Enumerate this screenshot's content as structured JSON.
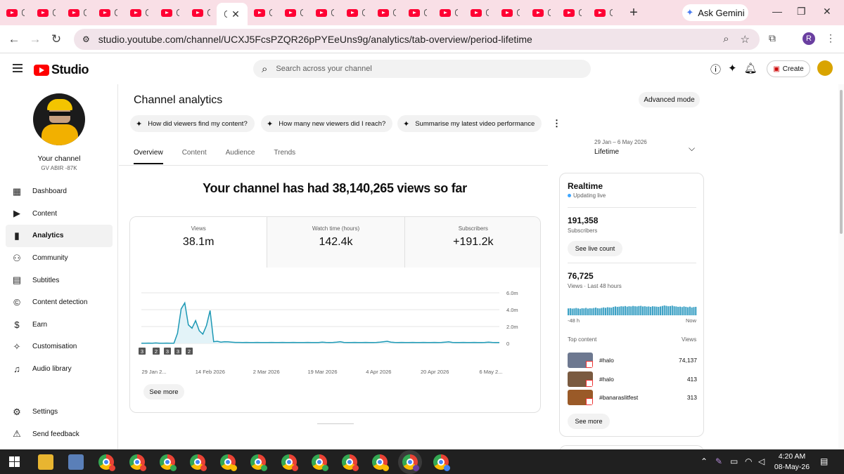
{
  "browser": {
    "ask_gemini": "Ask Gemini",
    "url": "studio.youtube.com/channel/UCXJ5FcsPZQR26pPYEeUns9g/analytics/tab-overview/period-lifetime",
    "profile_initial": "R"
  },
  "header": {
    "logo_text": "Studio",
    "search_placeholder": "Search across your channel",
    "create_label": "Create"
  },
  "sidebar": {
    "channel_name": "Your channel",
    "channel_handle": "GV ABIR -87K",
    "items": [
      {
        "label": "Dashboard",
        "icon": "dashboard-icon"
      },
      {
        "label": "Content",
        "icon": "content-icon"
      },
      {
        "label": "Analytics",
        "icon": "analytics-icon"
      },
      {
        "label": "Community",
        "icon": "community-icon"
      },
      {
        "label": "Subtitles",
        "icon": "subtitles-icon"
      },
      {
        "label": "Content detection",
        "icon": "copyright-icon"
      },
      {
        "label": "Earn",
        "icon": "earn-icon"
      },
      {
        "label": "Customisation",
        "icon": "magic-wand-icon"
      },
      {
        "label": "Audio library",
        "icon": "audio-library-icon"
      }
    ],
    "bottom": [
      {
        "label": "Settings",
        "icon": "gear-icon"
      },
      {
        "label": "Send feedback",
        "icon": "feedback-icon"
      }
    ],
    "active_index": 2
  },
  "analytics": {
    "title": "Channel analytics",
    "advanced_mode": "Advanced mode",
    "chips": [
      "How did viewers find my content?",
      "How many new viewers did I reach?",
      "Summarise my latest video performance"
    ],
    "tabs": [
      "Overview",
      "Content",
      "Audience",
      "Trends"
    ],
    "period_range": "29 Jan – 6 May 2026",
    "period_label": "Lifetime",
    "headline": "Your channel has had 38,140,265 views so far",
    "metrics": [
      {
        "label": "Views",
        "value": "38.1m"
      },
      {
        "label": "Watch time (hours)",
        "value": "142.4k"
      },
      {
        "label": "Subscribers",
        "value": "+191.2k"
      }
    ],
    "see_more": "See more"
  },
  "chart_data": {
    "type": "line",
    "x_labels": [
      "29 Jan 2...",
      "14 Feb 2026",
      "2 Mar 2026",
      "19 Mar 2026",
      "4 Apr 2026",
      "20 Apr 2026",
      "6 May 2..."
    ],
    "y_ticks": [
      "6.0m",
      "4.0m",
      "2.0m",
      "0"
    ],
    "ylim": [
      0,
      6.0
    ],
    "y_unit": "m",
    "markers": [
      "3",
      "2",
      "3",
      "3",
      "2"
    ],
    "series": [
      {
        "color": "#1c98b4",
        "values": [
          0.02,
          0.02,
          0.03,
          0.02,
          0.05,
          0.02,
          0.02,
          0.03,
          0.02,
          0.02,
          1.2,
          4.1,
          4.8,
          2.2,
          1.8,
          2.7,
          1.5,
          1.1,
          2.1,
          3.9,
          0.2,
          0.25,
          0.15,
          0.2,
          0.18,
          0.15,
          0.12,
          0.12,
          0.1,
          0.12,
          0.1,
          0.1,
          0.12,
          0.1,
          0.1,
          0.1,
          0.12,
          0.1,
          0.1,
          0.12,
          0.1,
          0.1,
          0.12,
          0.1,
          0.1,
          0.1,
          0.12,
          0.1,
          0.1,
          0.1,
          0.15,
          0.12,
          0.1,
          0.12,
          0.15,
          0.2,
          0.12,
          0.1,
          0.1,
          0.12,
          0.1,
          0.1,
          0.12,
          0.1,
          0.1,
          0.12,
          0.15,
          0.2,
          0.25,
          0.15,
          0.12,
          0.1,
          0.12,
          0.1,
          0.1,
          0.12,
          0.1,
          0.1,
          0.12,
          0.1,
          0.1,
          0.12,
          0.1,
          0.12,
          0.15,
          0.18,
          0.12,
          0.1,
          0.1,
          0.12,
          0.1,
          0.1,
          0.12,
          0.1,
          0.1,
          0.12,
          0.15,
          0.12,
          0.1,
          0.1
        ]
      }
    ]
  },
  "realtime": {
    "title": "Realtime",
    "status": "Updating live",
    "subscribers_value": "191,358",
    "subscribers_label": "Subscribers",
    "see_live_count": "See live count",
    "views_value": "76,725",
    "views_label": "Views · Last 48 hours",
    "bars": [
      0.7,
      0.72,
      0.68,
      0.7,
      0.74,
      0.7,
      0.66,
      0.72,
      0.7,
      0.75,
      0.68,
      0.72,
      0.7,
      0.74,
      0.78,
      0.72,
      0.7,
      0.75,
      0.8,
      0.76,
      0.82,
      0.8,
      0.78,
      0.85,
      0.9,
      0.86,
      0.88,
      0.92,
      0.9,
      0.94,
      0.88,
      0.92,
      0.9,
      0.95,
      0.92,
      0.9,
      0.94,
      0.96,
      0.9,
      0.92,
      0.88,
      0.9,
      0.86,
      0.92,
      0.9,
      0.88,
      0.86,
      0.9,
      0.95,
      1.0,
      0.96,
      0.92,
      0.94,
      0.98,
      0.92,
      0.9,
      0.86,
      0.88,
      0.84,
      0.9,
      0.86,
      0.82,
      0.88,
      0.8,
      0.84,
      0.86
    ],
    "axis_start": "-48 h",
    "axis_end": "Now",
    "top_content_label": "Top content",
    "views_col_label": "Views",
    "top_content": [
      {
        "name": "#halo",
        "views": "74,137",
        "thumb": "#6d7890"
      },
      {
        "name": "#halo",
        "views": "413",
        "thumb": "#7a5a40"
      },
      {
        "name": "#banaraslitfest",
        "views": "313",
        "thumb": "#9a5a28"
      }
    ],
    "see_more": "See more"
  },
  "taskbar": {
    "time": "4:20 AM",
    "date": "08-May-26"
  }
}
